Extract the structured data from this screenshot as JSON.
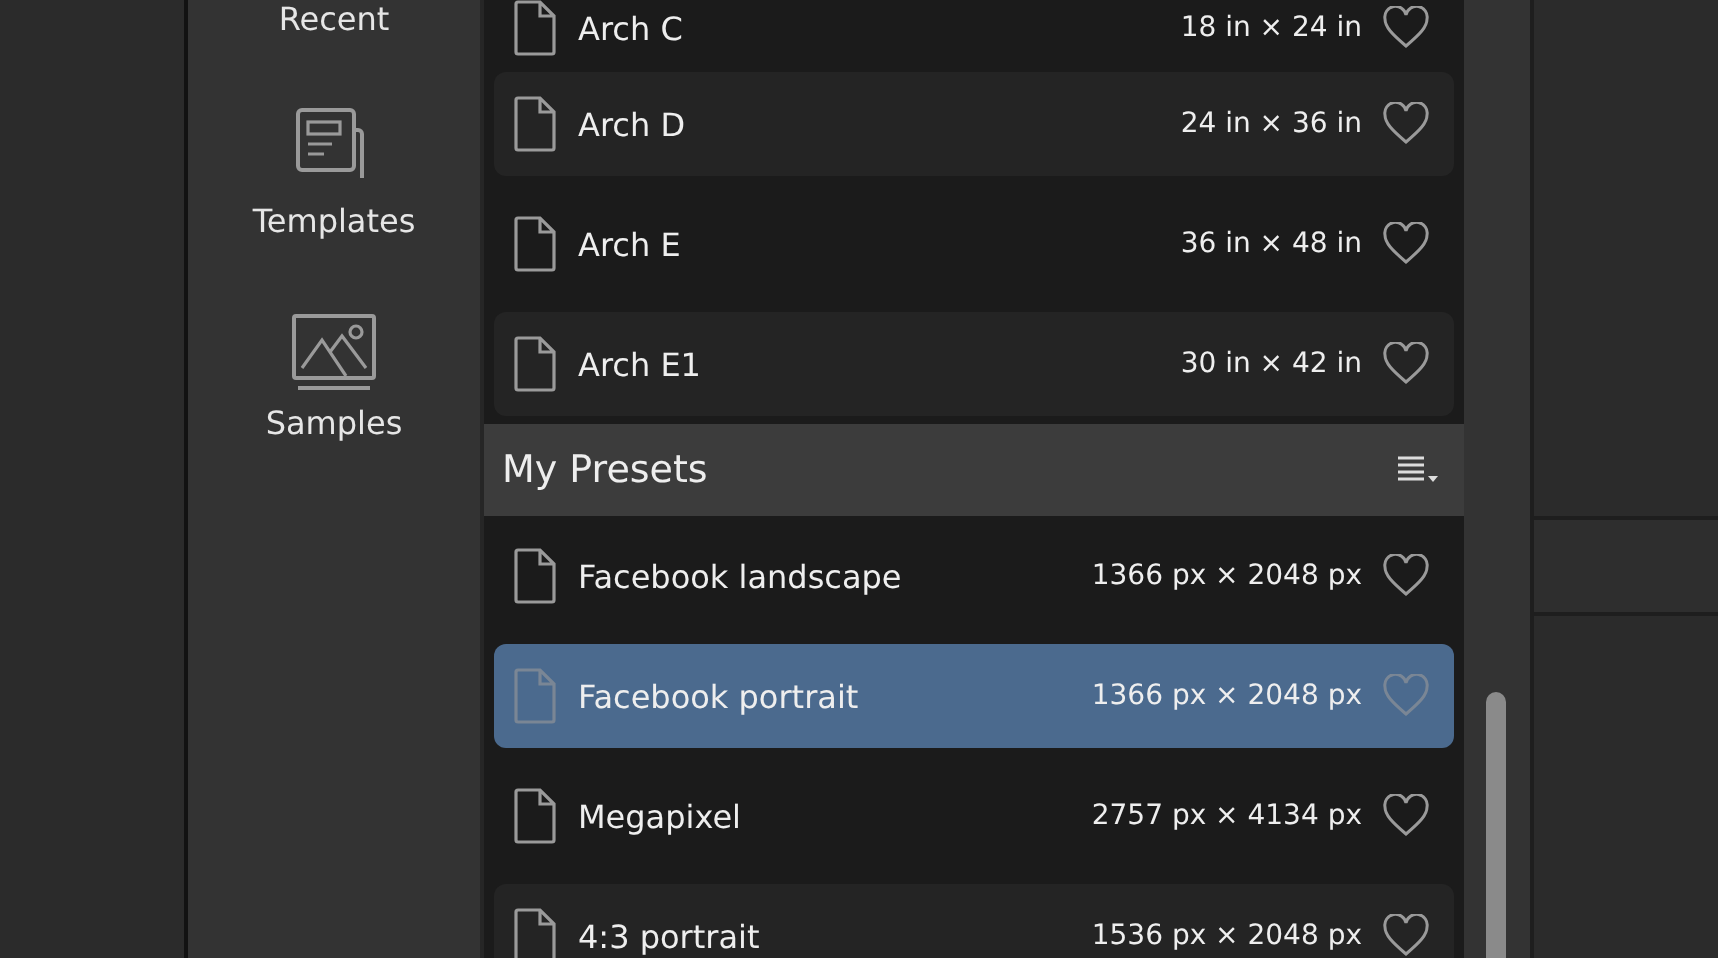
{
  "sidebar": {
    "items": [
      {
        "label": "Recent",
        "kind": "recent"
      },
      {
        "label": "Templates",
        "kind": "templates"
      },
      {
        "label": "Samples",
        "kind": "samples"
      }
    ]
  },
  "sections": [
    {
      "items": [
        {
          "name": "Arch C",
          "size": "18 in × 24 in",
          "selected": false
        },
        {
          "name": "Arch D",
          "size": "24 in × 36 in",
          "selected": false
        },
        {
          "name": "Arch E",
          "size": "36 in × 48 in",
          "selected": false
        },
        {
          "name": "Arch E1",
          "size": "30 in × 42 in",
          "selected": false
        }
      ]
    },
    {
      "title": "My Presets",
      "items": [
        {
          "name": "Facebook landscape",
          "size": "1366 px × 2048 px",
          "selected": false
        },
        {
          "name": "Facebook portrait",
          "size": "1366 px × 2048 px",
          "selected": true
        },
        {
          "name": "Megapixel",
          "size": "2757 px × 4134 px",
          "selected": false
        },
        {
          "name": "4:3 portrait",
          "size": "1536 px × 2048 px",
          "selected": false
        }
      ]
    }
  ]
}
